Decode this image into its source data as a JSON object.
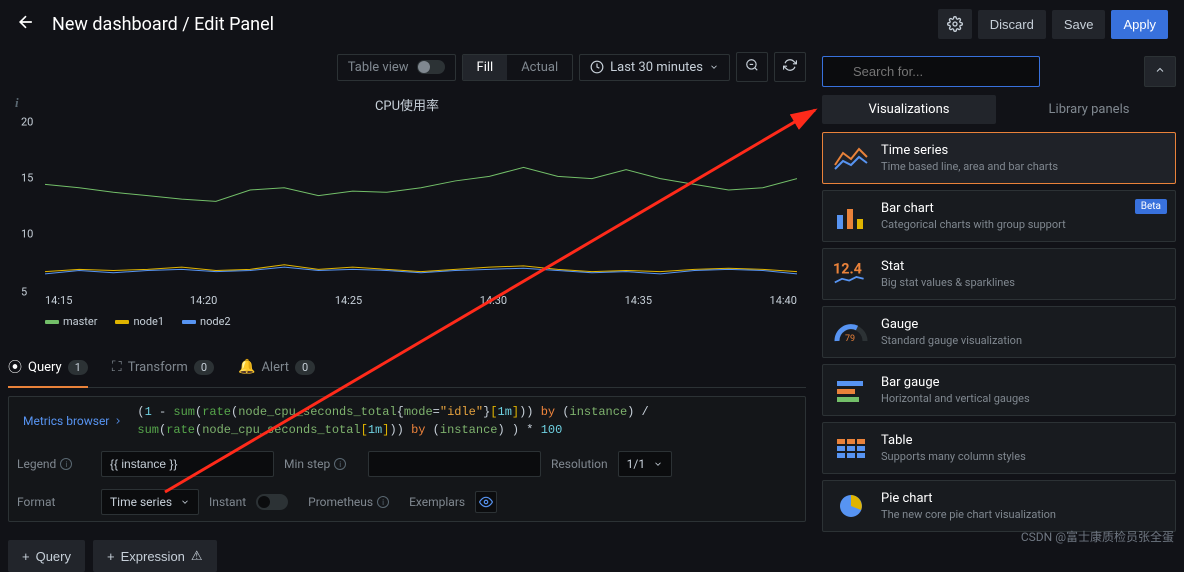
{
  "header": {
    "title": "New dashboard / Edit Panel",
    "discard": "Discard",
    "save": "Save",
    "apply": "Apply"
  },
  "toolbar": {
    "table_view": "Table view",
    "fill": "Fill",
    "actual": "Actual",
    "time_range": "Last 30 minutes"
  },
  "panel": {
    "title": "CPU使用率",
    "legend": [
      "master",
      "node1",
      "node2"
    ]
  },
  "chart_data": {
    "type": "line",
    "xlabel": "",
    "ylabel": "",
    "ylim": [
      5,
      20
    ],
    "x_ticks": [
      "14:15",
      "14:20",
      "14:25",
      "14:30",
      "14:35",
      "14:40"
    ],
    "y_ticks": [
      5,
      10,
      15,
      20
    ],
    "series": [
      {
        "name": "master",
        "color": "#73bf69",
        "values": [
          14.5,
          14.2,
          13.8,
          13.5,
          13.2,
          13.0,
          14.0,
          14.2,
          13.5,
          13.9,
          13.8,
          14.2,
          14.8,
          15.2,
          16.0,
          15.2,
          15.0,
          15.8,
          15.0,
          14.5,
          14.0,
          14.2,
          15.0
        ]
      },
      {
        "name": "node1",
        "color": "#e0b400",
        "values": [
          6.8,
          7.0,
          6.9,
          7.0,
          7.2,
          6.9,
          7.0,
          7.4,
          7.0,
          7.2,
          7.0,
          6.8,
          7.0,
          7.2,
          7.3,
          7.0,
          6.8,
          6.9,
          6.8,
          7.0,
          7.1,
          7.0,
          6.8
        ]
      },
      {
        "name": "node2",
        "color": "#5794f2",
        "values": [
          6.6,
          6.9,
          6.7,
          6.9,
          7.0,
          6.8,
          6.9,
          7.2,
          6.9,
          7.0,
          6.9,
          6.7,
          6.9,
          7.0,
          7.1,
          6.9,
          6.7,
          6.8,
          6.6,
          6.9,
          7.0,
          6.9,
          6.6
        ]
      }
    ]
  },
  "editor_tabs": {
    "query": "Query",
    "query_count": "1",
    "transform": "Transform",
    "transform_count": "0",
    "alert": "Alert",
    "alert_count": "0"
  },
  "query": {
    "metrics_browser": "Metrics browser",
    "expr_line1_html": "<span class='pu'>(</span><span class='num'>1</span> <span class='pu'>-</span> <span class='fn'>sum</span><span class='pu'>(</span><span class='fn'>rate</span><span class='pu'>(</span><span class='lb'>node_cpu_seconds_total</span><span class='pu'>{</span><span class='lb'>mode</span><span class='pu'>=</span><span class='str'>\"idle\"</span><span class='pu'>}</span><span class='br'>[</span><span class='num'>1m</span><span class='br'>]</span><span class='pu'>))</span> <span class='kw'>by</span> <span class='pu'>(</span><span class='lb'>instance</span><span class='pu'>)</span> <span class='pu'>/</span>",
    "expr_line2_html": "<span class='fn'>sum</span><span class='pu'>(</span><span class='fn'>rate</span><span class='pu'>(</span><span class='lb'>node_cpu_seconds_total</span><span class='br'>[</span><span class='num'>1m</span><span class='br'>]</span><span class='pu'>))</span> <span class='kw'>by</span> <span class='pu'>(</span><span class='lb'>instance</span><span class='pu'>)</span> <span class='pu'>)</span> <span class='pu'>*</span> <span class='num'>100</span>",
    "legend_label": "Legend",
    "legend_value": "{{ instance }}",
    "min_step_label": "Min step",
    "resolution_label": "Resolution",
    "resolution_value": "1/1",
    "format_label": "Format",
    "format_value": "Time series",
    "instant_label": "Instant",
    "prometheus_label": "Prometheus",
    "exemplars_label": "Exemplars"
  },
  "buttons": {
    "add_query": "Query",
    "add_expression": "Expression"
  },
  "right": {
    "search_placeholder": "Search for...",
    "tab_viz": "Visualizations",
    "tab_lib": "Library panels",
    "items": [
      {
        "name": "Time series",
        "desc": "Time based line, area and bar charts",
        "beta": false,
        "selected": true
      },
      {
        "name": "Bar chart",
        "desc": "Categorical charts with group support",
        "beta": true,
        "selected": false
      },
      {
        "name": "Stat",
        "desc": "Big stat values & sparklines",
        "beta": false,
        "selected": false
      },
      {
        "name": "Gauge",
        "desc": "Standard gauge visualization",
        "beta": false,
        "selected": false
      },
      {
        "name": "Bar gauge",
        "desc": "Horizontal and vertical gauges",
        "beta": false,
        "selected": false
      },
      {
        "name": "Table",
        "desc": "Supports many column styles",
        "beta": false,
        "selected": false
      },
      {
        "name": "Pie chart",
        "desc": "The new core pie chart visualization",
        "beta": false,
        "selected": false
      }
    ],
    "beta_label": "Beta"
  },
  "watermark": "CSDN @富士康质检员张全蛋"
}
